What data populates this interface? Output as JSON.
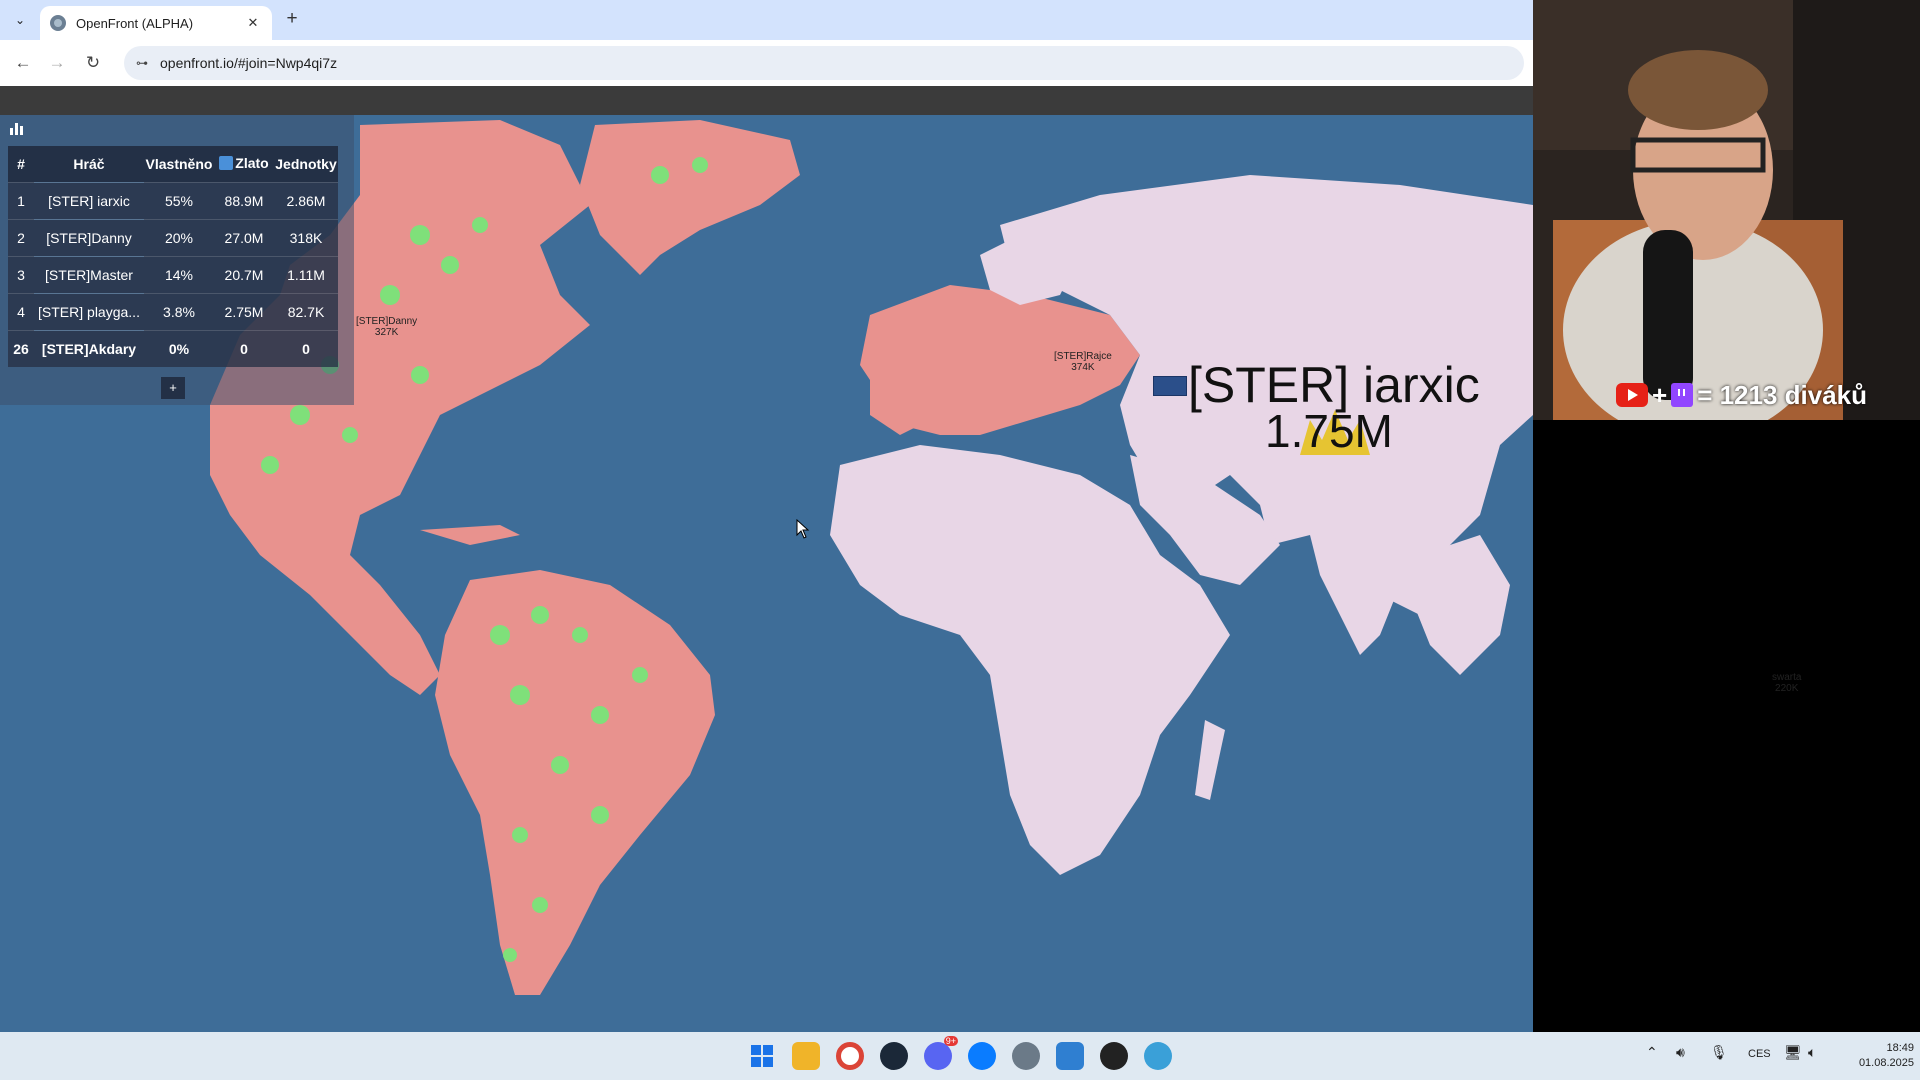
{
  "browser": {
    "tab_title": "OpenFront (ALPHA)",
    "tab_close": "✕",
    "tab_new": "+",
    "tab_menu": "⌄",
    "url": "openfront.io/#join=Nwp4qi7z",
    "back": "←",
    "forward": "→",
    "reload": "↻",
    "site_info": "⊶"
  },
  "leaderboard": {
    "icon": "bar-chart-icon",
    "columns": [
      "#",
      "Hráč",
      "Vlastněno",
      "Zlato",
      "Jednotky"
    ],
    "rows": [
      {
        "rank": "1",
        "name": "[STER] iarxic",
        "owned": "55%",
        "gold": "88.9M",
        "troops": "2.86M"
      },
      {
        "rank": "2",
        "name": "[STER]Danny",
        "owned": "20%",
        "gold": "27.0M",
        "troops": "318K"
      },
      {
        "rank": "3",
        "name": "[STER]Master",
        "owned": "14%",
        "gold": "20.7M",
        "troops": "1.11M"
      },
      {
        "rank": "4",
        "name": "[STER] playga...",
        "owned": "3.8%",
        "gold": "2.75M",
        "troops": "82.7K"
      },
      {
        "rank": "26",
        "name": "[STER]Akdary",
        "owned": "0%",
        "gold": "0",
        "troops": "0"
      }
    ],
    "expand": "+"
  },
  "map": {
    "player_name": "[STER] iarxic",
    "player_troops": "1.75M",
    "labels": [
      {
        "name": "[STER]Danny",
        "troops": "327K"
      },
      {
        "name": "[STER]Rajce",
        "troops": "374K"
      },
      {
        "name": "swarta",
        "troops": "220K"
      }
    ],
    "colors": {
      "ocean": "#3e6d98",
      "red_player": "#e8928e",
      "pink_player": "#e8d6e6",
      "magenta_player": "#d96bd8",
      "green_forest": "#7fe07a",
      "crown": "#e6c21e"
    }
  },
  "stream_overlay": {
    "viewer_text": "= 1213 diváků",
    "plus": "+"
  },
  "taskbar": {
    "apps": [
      "windows-start-icon",
      "file-explorer-icon",
      "chrome-icon",
      "steam-icon",
      "discord-icon",
      "messenger-icon",
      "settings-icon",
      "photos-icon",
      "obs-icon",
      "world-icon"
    ],
    "discord_badge": "9+",
    "language": "CES",
    "time": "18:49",
    "date": "01.08.2025"
  }
}
